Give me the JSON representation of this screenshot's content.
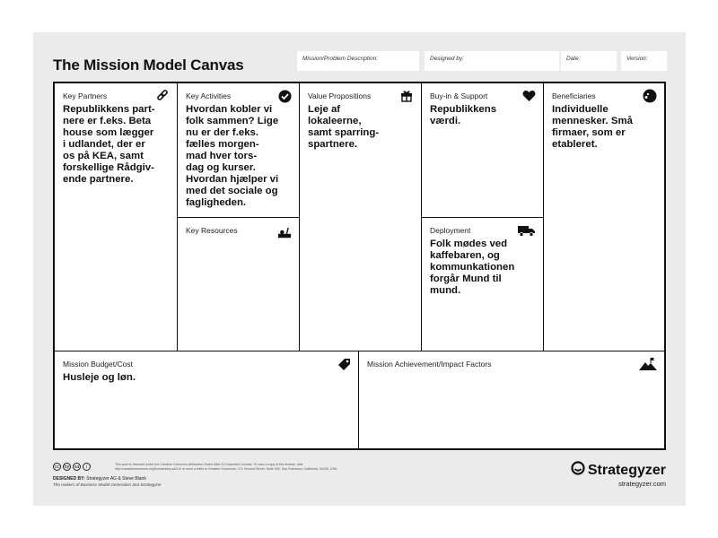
{
  "title": "The Mission Model Canvas",
  "meta": {
    "mission": "Mission/Problem Description:",
    "designed_by": "Designed by:",
    "date": "Date:",
    "version": "Version:"
  },
  "cells": {
    "key_partners": {
      "label": "Key Partners",
      "text": "Republikkens part-\nnere er f.eks. Beta\nhouse som lægger\ni udlandet, der er\nos på  KEA, samt\nforskellige Rådgiv-\nende partnere.",
      "icon": "link-icon"
    },
    "key_activities": {
      "label": "Key Activities",
      "text": "Hvordan kobler vi\nfolk sammen? Lige\nnu er der f.eks.\nfælles morgen-\nmad hver tors-\ndag og  kurser.\nHvordan hjælper vi\nmed det sociale og\nfagligheden.",
      "icon": "checkmark-icon"
    },
    "key_resources": {
      "label": "Key Resources",
      "text": "",
      "icon": "resources-icon"
    },
    "value_propositions": {
      "label": "Value Propositions",
      "text": "Leje af\nlokaleerne,\nsamt sparring-\nspartnere.",
      "icon": "gift-icon"
    },
    "buyin_support": {
      "label": "Buy-in & Support",
      "text": "Republikkens\nværdi.",
      "icon": "heart-icon"
    },
    "deployment": {
      "label": "Deployment",
      "text": "Folk mødes ved\nkaffebaren, og\nkommunkationen\nforgår Mund til\nmund.",
      "icon": "truck-icon"
    },
    "beneficiaries": {
      "label": "Beneficiaries",
      "text": "Individuelle\nmennesker. Små\nfirmaer, som er\netableret.",
      "icon": "face-icon"
    },
    "budget": {
      "label": "Mission Budget/Cost",
      "text": "Husleje og løn.",
      "icon": "tag-icon"
    },
    "achievement": {
      "label": "Mission Achievement/Impact Factors",
      "text": "",
      "icon": "mountain-flag-icon"
    }
  },
  "footer": {
    "cc_icons": [
      "cc",
      "by",
      "sa",
      "i"
    ],
    "license": "This work is licensed under the Creative Commons Attribution-Share Alike 3.0 Unported License. To view a copy of this license, visit: http://creativecommons.org/licenses/by-sa/3.0/ or send a letter to Creative Commons, 171 Second Street, Suite 300, San Francisco, California, 94105, USA.",
    "designed_label": "DESIGNED BY:",
    "designed_by": "Strategyzer AG & Steve Blank",
    "makers": "The makers of Business Model Generation and Strategyzer",
    "brand": "Strategyzer",
    "brand_url": "strategyzer.com"
  }
}
